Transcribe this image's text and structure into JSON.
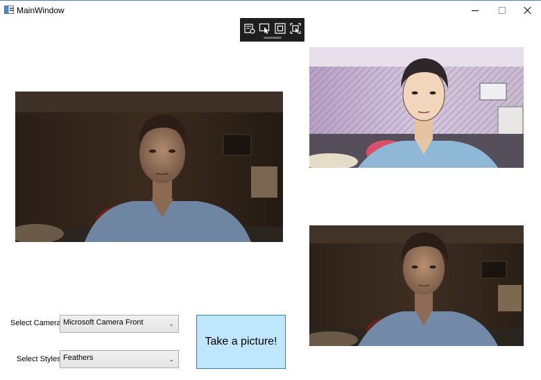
{
  "window": {
    "title": "MainWindow"
  },
  "debug_toolbar": {
    "icons": [
      "live-visual-tree-icon",
      "select-element-icon",
      "display-layout-adorners-icon",
      "track-focus-icon"
    ]
  },
  "images": {
    "main_preview": {
      "alt": "live camera preview",
      "style": "original"
    },
    "styled_preview": {
      "alt": "stylized camera preview",
      "style": "sketch"
    },
    "captured_preview": {
      "alt": "captured picture",
      "style": "original"
    }
  },
  "controls": {
    "camera_label": "Select Camera:",
    "camera_value": "Microsoft Camera Front",
    "styles_label": "Select Styles:",
    "styles_value": "Feathers",
    "take_picture_label": "Take a picture!"
  },
  "colors": {
    "button_bg": "#bee6fd",
    "button_border": "#3c7fb1",
    "toolbar_bg": "#1e1e1e"
  }
}
